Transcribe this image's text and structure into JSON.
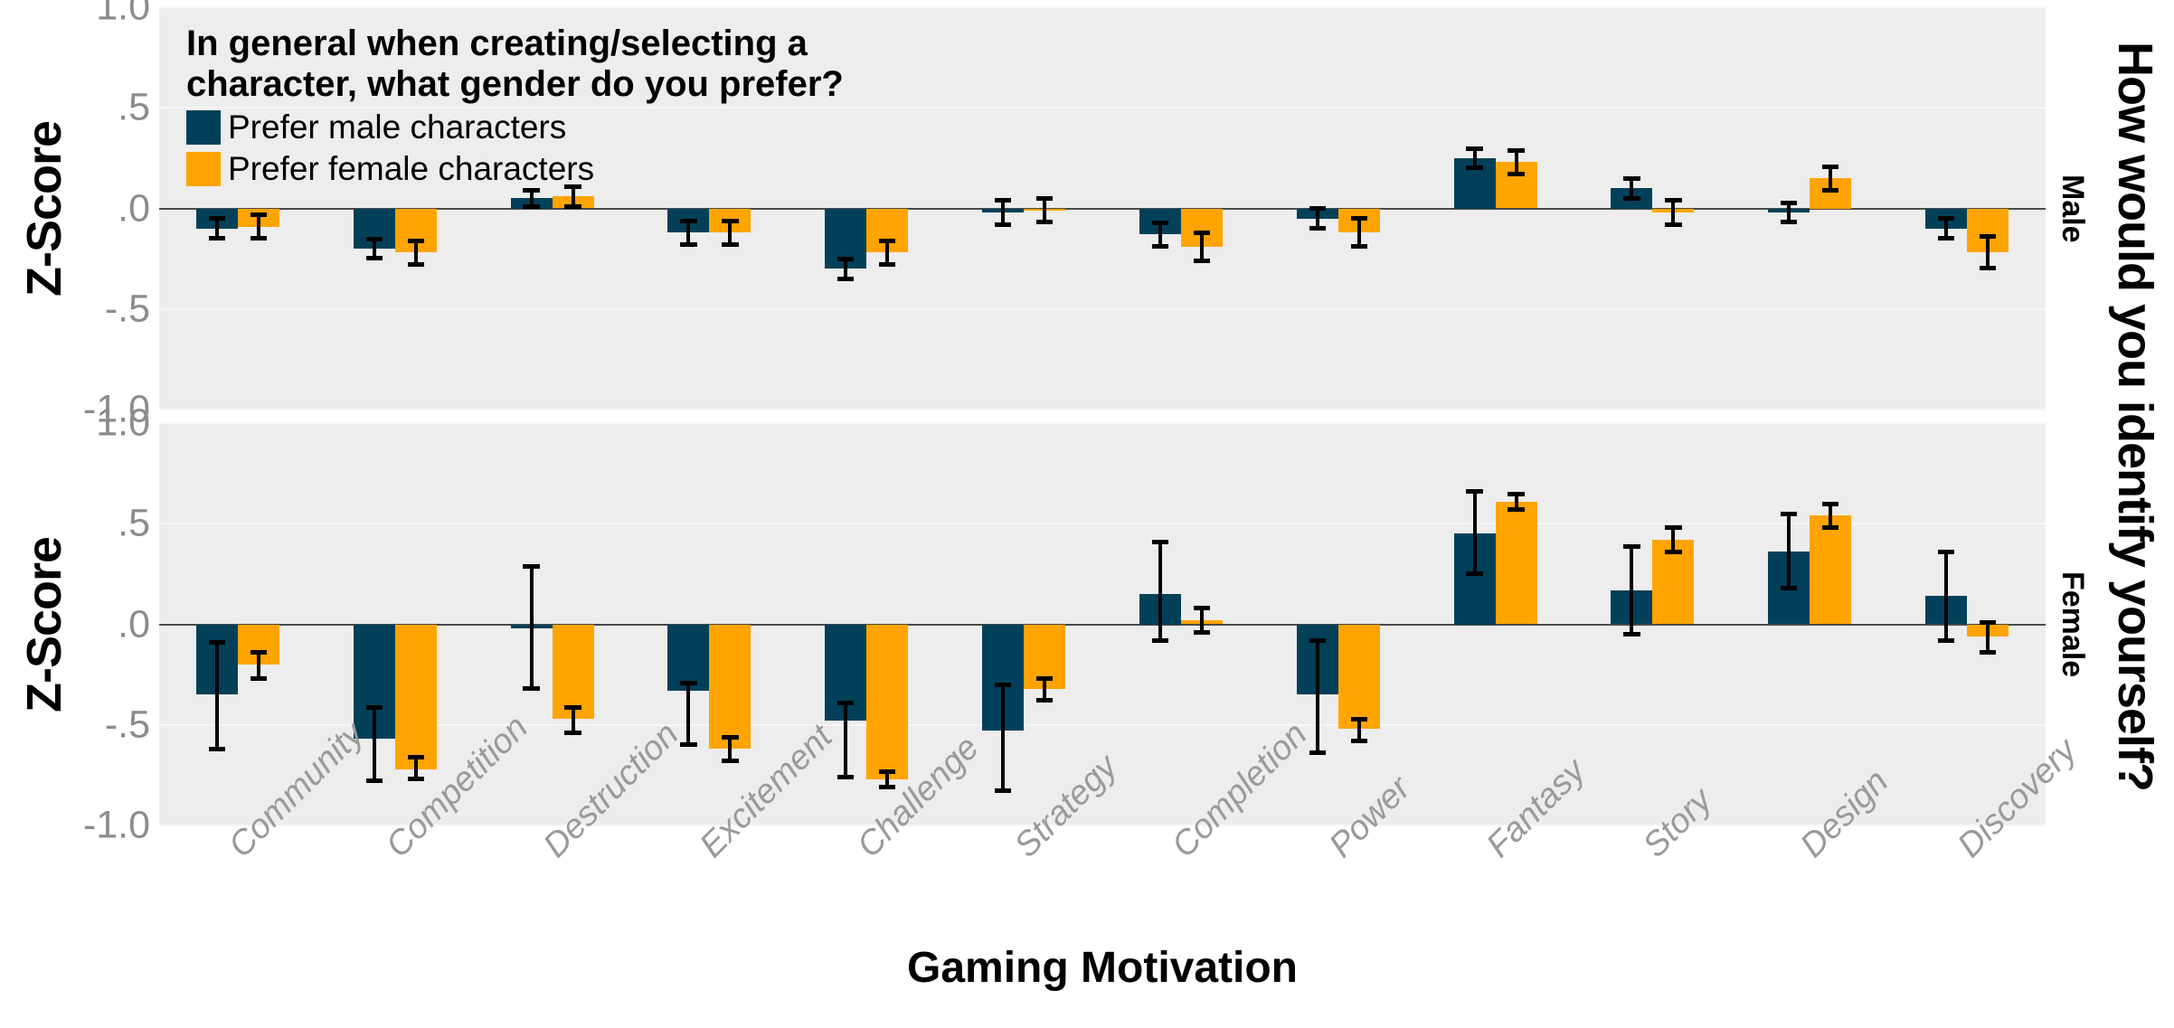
{
  "axes": {
    "y_label": "Z-Score",
    "x_label": "Gaming Motivation",
    "y_ticks": [
      "1.0",
      ".5",
      ".0",
      "-.5",
      "-1.0"
    ],
    "y_tick_values": [
      1.0,
      0.5,
      0.0,
      -0.5,
      -1.0
    ],
    "right_outer_label": "How would you identify yourself?",
    "panel_labels": [
      "Male",
      "Female"
    ]
  },
  "legend": {
    "title": "In general when creating/selecting a\ncharacter, what gender do you prefer?",
    "entries": [
      {
        "label": "Prefer male characters",
        "color": "#024059"
      },
      {
        "label": "Prefer female characters",
        "color": "#ffa400"
      }
    ]
  },
  "colors": {
    "male": "#024059",
    "female": "#ffa400",
    "panel_bg": "#ededed",
    "gridline": "#f7f7f7",
    "zeroline": "#4a4a4a",
    "tick_text": "#8c8c8c",
    "xlabel_text": "#9a9a9a"
  },
  "chart_data": {
    "type": "bar",
    "title": "",
    "xlabel": "Gaming Motivation",
    "ylabel": "Z-Score",
    "ylim": [
      -1.0,
      1.0
    ],
    "grid": true,
    "legend_position": "inside-top-left",
    "error_bars": "95% CI",
    "categories": [
      "Community",
      "Competition",
      "Destruction",
      "Excitement",
      "Challenge",
      "Strategy",
      "Completion",
      "Power",
      "Fantasy",
      "Story",
      "Design",
      "Discovery"
    ],
    "panels": [
      {
        "name": "Male",
        "series": [
          {
            "name": "Prefer male characters",
            "color": "#024059",
            "values": [
              -0.1,
              -0.2,
              0.05,
              -0.12,
              -0.3,
              -0.02,
              -0.13,
              -0.05,
              0.25,
              0.1,
              -0.02,
              -0.1
            ],
            "err_low": [
              -0.16,
              -0.26,
              0.0,
              -0.19,
              -0.36,
              -0.09,
              -0.2,
              -0.11,
              0.19,
              0.04,
              -0.08,
              -0.16
            ],
            "err_high": [
              -0.04,
              -0.14,
              0.1,
              -0.05,
              -0.24,
              0.05,
              -0.06,
              0.01,
              0.31,
              0.16,
              0.04,
              -0.04
            ]
          },
          {
            "name": "Prefer female characters",
            "color": "#ffa400",
            "values": [
              -0.09,
              -0.22,
              0.06,
              -0.12,
              -0.22,
              -0.01,
              -0.19,
              -0.12,
              0.23,
              -0.02,
              0.15,
              -0.22
            ],
            "err_low": [
              -0.16,
              -0.29,
              0.0,
              -0.19,
              -0.29,
              -0.08,
              -0.27,
              -0.2,
              0.16,
              -0.09,
              0.08,
              -0.31
            ],
            "err_high": [
              -0.02,
              -0.15,
              0.12,
              -0.05,
              -0.15,
              0.06,
              -0.11,
              -0.04,
              0.3,
              0.05,
              0.22,
              -0.13
            ]
          }
        ]
      },
      {
        "name": "Female",
        "series": [
          {
            "name": "Prefer male characters",
            "color": "#024059",
            "values": [
              -0.35,
              -0.57,
              -0.02,
              -0.33,
              -0.48,
              -0.53,
              0.15,
              -0.35,
              0.45,
              0.17,
              0.36,
              0.14
            ],
            "err_low": [
              -0.63,
              -0.79,
              -0.33,
              -0.61,
              -0.77,
              -0.84,
              -0.09,
              -0.65,
              0.24,
              -0.06,
              0.17,
              -0.09
            ],
            "err_high": [
              -0.08,
              -0.4,
              0.3,
              -0.28,
              -0.38,
              -0.29,
              0.42,
              -0.07,
              0.67,
              0.4,
              0.56,
              0.37
            ]
          },
          {
            "name": "Prefer female characters",
            "color": "#ffa400",
            "values": [
              -0.2,
              -0.72,
              -0.47,
              -0.62,
              -0.77,
              -0.32,
              0.02,
              -0.52,
              0.61,
              0.42,
              0.54,
              -0.06
            ],
            "err_low": [
              -0.28,
              -0.78,
              -0.55,
              -0.69,
              -0.82,
              -0.39,
              -0.05,
              -0.59,
              0.56,
              0.35,
              0.47,
              -0.15
            ],
            "err_high": [
              -0.13,
              -0.65,
              -0.4,
              -0.55,
              -0.72,
              -0.26,
              0.09,
              -0.46,
              0.66,
              0.49,
              0.61,
              0.02
            ]
          }
        ]
      }
    ]
  }
}
